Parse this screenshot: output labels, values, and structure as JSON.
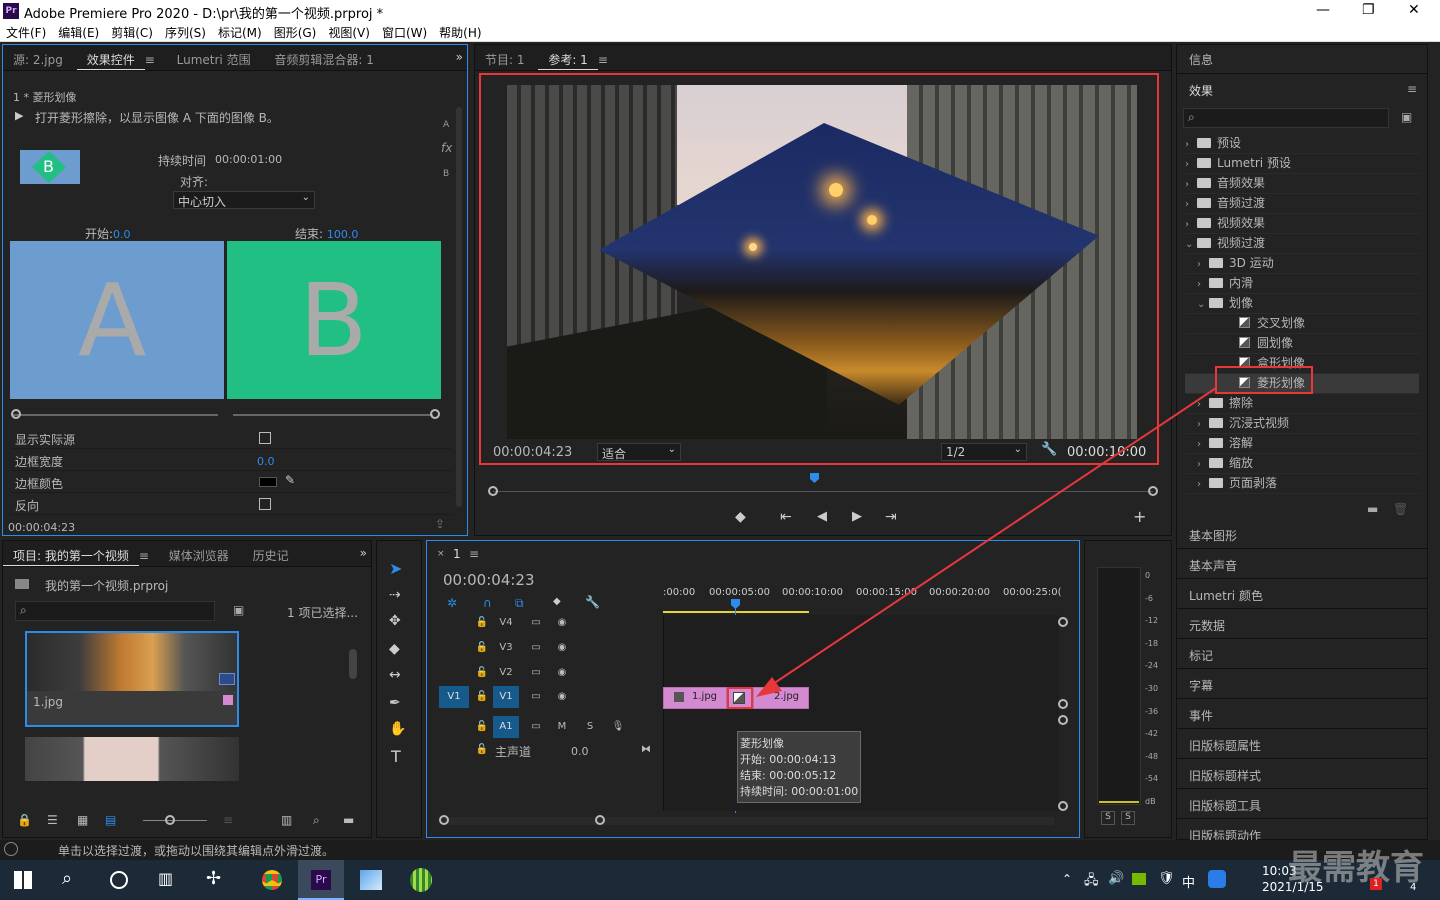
{
  "window": {
    "title": "Adobe Premiere Pro 2020 - D:\\pr\\我的第一个视频.prproj *",
    "minimize": "—",
    "maximize": "❐",
    "close": "✕"
  },
  "menu": [
    "文件(F)",
    "编辑(E)",
    "剪辑(C)",
    "序列(S)",
    "标记(M)",
    "图形(G)",
    "视图(V)",
    "窗口(W)",
    "帮助(H)"
  ],
  "effect_controls": {
    "tabs": [
      "源: 2.jpg",
      "效果控件",
      "Lumetri 范围",
      "音频剪辑混合器: 1"
    ],
    "clip_label": "1 * 菱形划像",
    "description": "打开菱形擦除，以显示图像 A 下面的图像 B。",
    "duration_label": "持续时间",
    "duration_value": "00:00:01:00",
    "align_label": "对齐:",
    "align_value": "中心切入",
    "start_label": "开始:",
    "start_value": "0.0",
    "end_label": "结束:",
    "end_value": "100.0",
    "a_letter": "A",
    "b_letter": "B",
    "thumb_letter": "B",
    "side_letters": {
      "a": "A",
      "fx": "fx",
      "b": "B"
    },
    "props": [
      {
        "label": "显示实际源",
        "value": ""
      },
      {
        "label": "边框宽度",
        "value": "0.0"
      },
      {
        "label": "边框颜色",
        "value": ""
      },
      {
        "label": "反向",
        "value": ""
      }
    ],
    "timecode": "00:00:04:23"
  },
  "program": {
    "tabs": [
      "节目: 1",
      "参考: 1"
    ],
    "timecode": "00:00:04:23",
    "fit": "适合",
    "quality": "1/2",
    "duration": "00:00:10:00"
  },
  "project": {
    "tabs": [
      "项目: 我的第一个视频",
      "媒体浏览器",
      "历史记"
    ],
    "file": "我的第一个视频.prproj",
    "selection": "1 项已选择...",
    "items": [
      {
        "name": "1.jpg"
      }
    ]
  },
  "timeline": {
    "tab": "1",
    "timecode": "00:00:04:23",
    "ruler": [
      ":00:00",
      "00:00:05:00",
      "00:00:10:00",
      "00:00:15:00",
      "00:00:20:00",
      "00:00:25:0("
    ],
    "tracks": [
      "V4",
      "V3",
      "V2",
      "V1",
      "A1"
    ],
    "src_patch_v": "V1",
    "src_patch_a": "A1",
    "master_label": "主声道",
    "master_value": "0.0",
    "m": "M",
    "s": "S",
    "clips": [
      "1.jpg",
      "2.jpg"
    ],
    "tooltip": {
      "name": "菱形划像",
      "start": "开始: 00:00:04:13",
      "end": "结束: 00:00:05:12",
      "duration": "持续时间: 00:00:01:00"
    }
  },
  "meter": {
    "scale": [
      "0",
      "-6",
      "-12",
      "-18",
      "-24",
      "-30",
      "-36",
      "-42",
      "-48",
      "-54",
      "dB"
    ],
    "solo": [
      "S",
      "S"
    ]
  },
  "effects_panel": {
    "info_tab": "信息",
    "tab": "效果",
    "tree": [
      {
        "label": "预设",
        "level": 0,
        "kind": "folder",
        "open": false
      },
      {
        "label": "Lumetri 预设",
        "level": 0,
        "kind": "folder",
        "open": false
      },
      {
        "label": "音频效果",
        "level": 0,
        "kind": "folder",
        "open": false
      },
      {
        "label": "音频过渡",
        "level": 0,
        "kind": "folder",
        "open": false
      },
      {
        "label": "视频效果",
        "level": 0,
        "kind": "folder",
        "open": false
      },
      {
        "label": "视频过渡",
        "level": 0,
        "kind": "folder",
        "open": true
      },
      {
        "label": "3D 运动",
        "level": 1,
        "kind": "folder",
        "open": false
      },
      {
        "label": "内滑",
        "level": 1,
        "kind": "folder",
        "open": false
      },
      {
        "label": "划像",
        "level": 1,
        "kind": "folder",
        "open": true
      },
      {
        "label": "交叉划像",
        "level": 2,
        "kind": "effect"
      },
      {
        "label": "圆划像",
        "level": 2,
        "kind": "effect"
      },
      {
        "label": "盒形划像",
        "level": 2,
        "kind": "effect"
      },
      {
        "label": "菱形划像",
        "level": 2,
        "kind": "effect",
        "selected": true
      },
      {
        "label": "擦除",
        "level": 1,
        "kind": "folder",
        "open": false
      },
      {
        "label": "沉浸式视频",
        "level": 1,
        "kind": "folder",
        "open": false
      },
      {
        "label": "溶解",
        "level": 1,
        "kind": "folder",
        "open": false
      },
      {
        "label": "缩放",
        "level": 1,
        "kind": "folder",
        "open": false
      },
      {
        "label": "页面剥落",
        "level": 1,
        "kind": "folder",
        "open": false
      }
    ],
    "side_panels": [
      "基本图形",
      "基本声音",
      "Lumetri 颜色",
      "元数据",
      "标记",
      "字幕",
      "事件",
      "旧版标题属性",
      "旧版标题样式",
      "旧版标题工具",
      "旧版标题动作"
    ]
  },
  "status": {
    "text": "单击以选择过渡，或拖动以围绕其编辑点外滑过渡。"
  },
  "taskbar": {
    "time": "10:03",
    "date": "2021/1/15",
    "ime": "中",
    "watermark": "最需教育",
    "badge_a": "1",
    "badge_b": "4"
  },
  "colors": {
    "accent": "#2d8ceb",
    "highlight": "#e8373b",
    "a_box": "#6d9ccf",
    "b_box": "#21bf84",
    "clip_pink": "#d48ad0"
  }
}
